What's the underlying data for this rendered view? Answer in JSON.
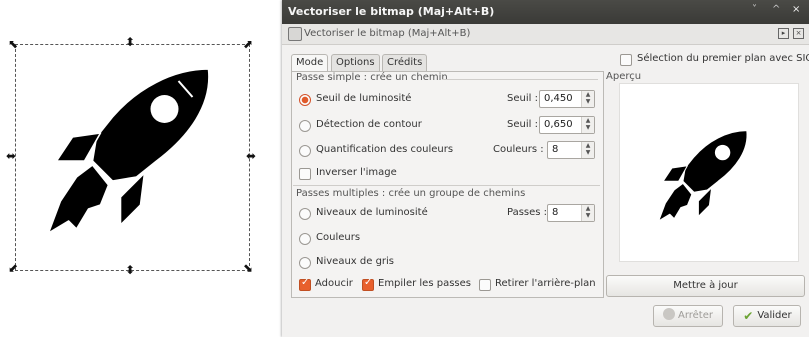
{
  "window": {
    "title": "Vectoriser le bitmap (Maj+Alt+B)",
    "doc_title": "Vectoriser le bitmap (Maj+Alt+B)",
    "controls": [
      "˅",
      "^",
      "×"
    ]
  },
  "tabs": [
    {
      "label": "Mode",
      "active": true
    },
    {
      "label": "Options",
      "active": false
    },
    {
      "label": "Crédits",
      "active": false
    }
  ],
  "simple": {
    "title": "Passe simple : crée un chemin",
    "options": [
      {
        "label": "Seuil de luminosité",
        "selected": true,
        "param_label": "Seuil :",
        "value": "0,450"
      },
      {
        "label": "Détection de contour",
        "selected": false,
        "param_label": "Seuil :",
        "value": "0,650"
      },
      {
        "label": "Quantification des couleurs",
        "selected": false,
        "param_label": "Couleurs :",
        "value": "8"
      }
    ],
    "invert": {
      "label": "Inverser l'image",
      "checked": false
    }
  },
  "multiple": {
    "title": "Passes multiples : crée un groupe de chemins",
    "options": [
      {
        "label": "Niveaux de luminosité",
        "selected": false,
        "param_label": "Passes :",
        "value": "8"
      },
      {
        "label": "Couleurs",
        "selected": false
      },
      {
        "label": "Niveaux de gris",
        "selected": false
      }
    ],
    "checks": [
      {
        "label": "Adoucir",
        "checked": true
      },
      {
        "label": "Empiler les passes",
        "checked": true
      },
      {
        "label": "Retirer l'arrière-plan",
        "checked": false
      }
    ]
  },
  "siox": {
    "label": "Sélection du premier plan avec SIOX",
    "checked": false
  },
  "preview": {
    "title": "Aperçu"
  },
  "buttons": {
    "update": "Mettre à jour",
    "stop": "Arrêter",
    "ok": "Valider"
  },
  "colors": {
    "accent": "#e05a2b",
    "titlebar": "#3f3f3c",
    "ok_icon": "#6aa332"
  }
}
